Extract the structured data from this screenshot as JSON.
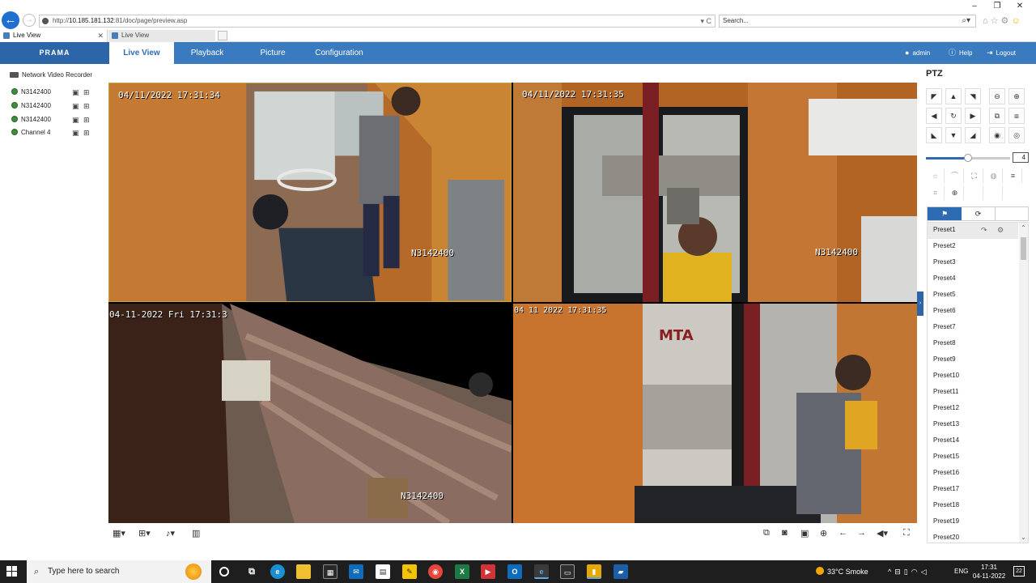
{
  "browser": {
    "url_prefix": "http://",
    "url_host": "10.185.181.132",
    "url_path": ":81/doc/page/preview.asp",
    "url_tools": "▾ C",
    "search_placeholder": "Search...",
    "search_icon": "search-icon",
    "tabs": [
      {
        "title": "Live View"
      },
      {
        "title": "Live View"
      }
    ],
    "window_controls": [
      "–",
      "❐",
      "✕"
    ]
  },
  "app": {
    "logo": "PRAMA",
    "nav": [
      {
        "label": "Live View",
        "active": true
      },
      {
        "label": "Playback"
      },
      {
        "label": "Picture"
      },
      {
        "label": "Configuration"
      }
    ],
    "user": "admin",
    "help": "Help",
    "logout": "Logout",
    "accent_color": "#3a7abf",
    "logo_bg": "#2c65a8"
  },
  "device_tree": {
    "root": "Network Video Recorder",
    "channels": [
      {
        "name": "N3142400"
      },
      {
        "name": "N3142400"
      },
      {
        "name": "N3142400"
      },
      {
        "name": "Channel 4"
      }
    ]
  },
  "video": {
    "tiles": [
      {
        "timestamp": "04/11/2022 17:31:34",
        "camera_name": "N3142400",
        "selected": true
      },
      {
        "timestamp": "04/11/2022 17:31:35",
        "camera_name": "N3142400"
      },
      {
        "timestamp": "04-11-2022 Fri 17:31:3",
        "camera_name": "N3142400"
      },
      {
        "timestamp": "04 11 2022 17:31:35",
        "camera_name": ""
      }
    ]
  },
  "ptz": {
    "title": "PTZ",
    "speed": 4,
    "speed_max": 7,
    "presets": [
      "Preset1",
      "Preset2",
      "Preset3",
      "Preset4",
      "Preset5",
      "Preset6",
      "Preset7",
      "Preset8",
      "Preset9",
      "Preset10",
      "Preset11",
      "Preset12",
      "Preset13",
      "Preset14",
      "Preset15",
      "Preset16",
      "Preset17",
      "Preset18",
      "Preset19",
      "Preset20"
    ]
  },
  "taskbar": {
    "search_placeholder": "Type here to search",
    "weather": "33°C  Smoke",
    "language": "ENG",
    "time": "17:31",
    "date": "04-11-2022",
    "notifications": "22"
  }
}
